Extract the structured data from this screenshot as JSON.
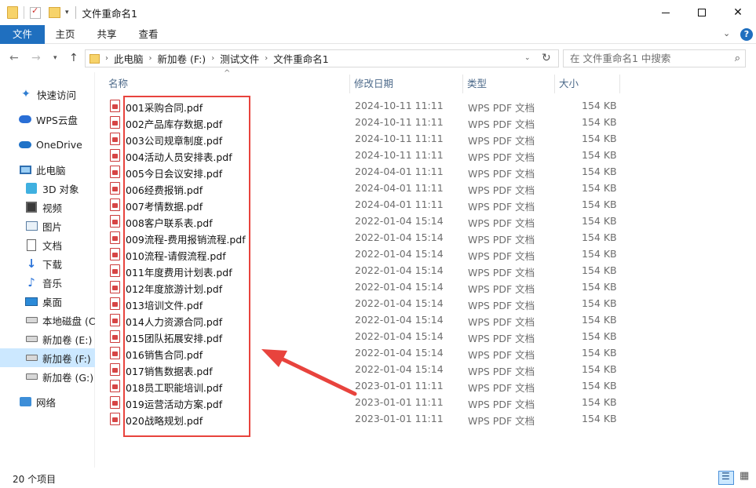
{
  "window": {
    "title": "文件重命名1",
    "controls": {
      "minimize": "—",
      "maximize": "☐",
      "close": "✕"
    }
  },
  "ribbon": {
    "tabs": [
      "文件",
      "主页",
      "共享",
      "查看"
    ],
    "help": "?"
  },
  "address": {
    "crumbs": [
      "此电脑",
      "新加卷 (F:)",
      "测试文件",
      "文件重命名1"
    ],
    "search_placeholder": "在 文件重命名1 中搜索"
  },
  "sidebar": {
    "items": [
      {
        "label": "快速访问",
        "icon": "star-icon"
      },
      {
        "label": "WPS云盘",
        "icon": "cloud-icon"
      },
      {
        "label": "OneDrive",
        "icon": "onedrive-icon"
      },
      {
        "label": "此电脑",
        "icon": "pc-icon"
      },
      {
        "label": "3D 对象",
        "icon": "3d-objects-icon"
      },
      {
        "label": "视频",
        "icon": "video-icon"
      },
      {
        "label": "图片",
        "icon": "pictures-icon"
      },
      {
        "label": "文档",
        "icon": "documents-icon"
      },
      {
        "label": "下载",
        "icon": "download-icon"
      },
      {
        "label": "音乐",
        "icon": "music-icon"
      },
      {
        "label": "桌面",
        "icon": "desktop-icon"
      },
      {
        "label": "本地磁盘 (C",
        "icon": "drive-icon"
      },
      {
        "label": "新加卷 (E:)",
        "icon": "drive-icon"
      },
      {
        "label": "新加卷 (F:)",
        "icon": "drive-icon"
      },
      {
        "label": "新加卷 (G:)",
        "icon": "drive-icon"
      },
      {
        "label": "网络",
        "icon": "network-icon"
      }
    ]
  },
  "list": {
    "headers": {
      "name": "名称",
      "date": "修改日期",
      "type": "类型",
      "size": "大小"
    },
    "files": [
      {
        "name": "001采购合同.pdf",
        "date": "2024-10-11 11:11",
        "type": "WPS PDF 文档",
        "size": "154 KB"
      },
      {
        "name": "002产品库存数据.pdf",
        "date": "2024-10-11 11:11",
        "type": "WPS PDF 文档",
        "size": "154 KB"
      },
      {
        "name": "003公司规章制度.pdf",
        "date": "2024-10-11 11:11",
        "type": "WPS PDF 文档",
        "size": "154 KB"
      },
      {
        "name": "004活动人员安排表.pdf",
        "date": "2024-10-11 11:11",
        "type": "WPS PDF 文档",
        "size": "154 KB"
      },
      {
        "name": "005今日会议安排.pdf",
        "date": "2024-04-01 11:11",
        "type": "WPS PDF 文档",
        "size": "154 KB"
      },
      {
        "name": "006经费报销.pdf",
        "date": "2024-04-01 11:11",
        "type": "WPS PDF 文档",
        "size": "154 KB"
      },
      {
        "name": "007考情数据.pdf",
        "date": "2024-04-01 11:11",
        "type": "WPS PDF 文档",
        "size": "154 KB"
      },
      {
        "name": "008客户联系表.pdf",
        "date": "2022-01-04 15:14",
        "type": "WPS PDF 文档",
        "size": "154 KB"
      },
      {
        "name": "009流程-费用报销流程.pdf",
        "date": "2022-01-04 15:14",
        "type": "WPS PDF 文档",
        "size": "154 KB"
      },
      {
        "name": "010流程-请假流程.pdf",
        "date": "2022-01-04 15:14",
        "type": "WPS PDF 文档",
        "size": "154 KB"
      },
      {
        "name": "011年度费用计划表.pdf",
        "date": "2022-01-04 15:14",
        "type": "WPS PDF 文档",
        "size": "154 KB"
      },
      {
        "name": "012年度旅游计划.pdf",
        "date": "2022-01-04 15:14",
        "type": "WPS PDF 文档",
        "size": "154 KB"
      },
      {
        "name": "013培训文件.pdf",
        "date": "2022-01-04 15:14",
        "type": "WPS PDF 文档",
        "size": "154 KB"
      },
      {
        "name": "014人力资源合同.pdf",
        "date": "2022-01-04 15:14",
        "type": "WPS PDF 文档",
        "size": "154 KB"
      },
      {
        "name": "015团队拓展安排.pdf",
        "date": "2022-01-04 15:14",
        "type": "WPS PDF 文档",
        "size": "154 KB"
      },
      {
        "name": "016销售合同.pdf",
        "date": "2022-01-04 15:14",
        "type": "WPS PDF 文档",
        "size": "154 KB"
      },
      {
        "name": "017销售数据表.pdf",
        "date": "2022-01-04 15:14",
        "type": "WPS PDF 文档",
        "size": "154 KB"
      },
      {
        "name": "018员工职能培训.pdf",
        "date": "2023-01-01 11:11",
        "type": "WPS PDF 文档",
        "size": "154 KB"
      },
      {
        "name": "019运营活动方案.pdf",
        "date": "2023-01-01 11:11",
        "type": "WPS PDF 文档",
        "size": "154 KB"
      },
      {
        "name": "020战略规划.pdf",
        "date": "2023-01-01 11:11",
        "type": "WPS PDF 文档",
        "size": "154 KB"
      }
    ]
  },
  "status": {
    "count_text": "20 个项目"
  },
  "colors": {
    "accent": "#1f6fbf",
    "annotation": "#e8433d",
    "selected": "#cce8ff"
  }
}
